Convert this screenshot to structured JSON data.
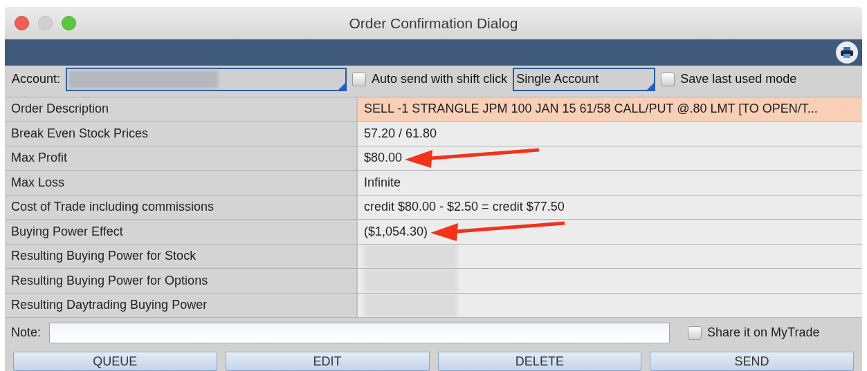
{
  "window": {
    "title": "Order Confirmation Dialog"
  },
  "account": {
    "label": "Account:",
    "redacted": true
  },
  "auto_send": {
    "label": "Auto send with shift click",
    "checked": false
  },
  "mode": {
    "value": "Single Account"
  },
  "save_mode": {
    "label": "Save last used mode",
    "checked": false
  },
  "rows": [
    {
      "label": "Order Description",
      "value": "SELL -1 STRANGLE JPM 100 JAN 15 61/58 CALL/PUT @.80 LMT [TO OPEN/T...",
      "highlight": true,
      "arrow": false,
      "redacted": false
    },
    {
      "label": "Break Even Stock Prices",
      "value": "57.20 / 61.80",
      "highlight": false,
      "arrow": false,
      "redacted": false
    },
    {
      "label": "Max Profit",
      "value": "$80.00",
      "highlight": false,
      "arrow": true,
      "redacted": false
    },
    {
      "label": "Max Loss",
      "value": "Infinite",
      "highlight": false,
      "arrow": false,
      "redacted": false
    },
    {
      "label": "Cost of Trade including commissions",
      "value": "credit $80.00 - $2.50 = credit $77.50",
      "highlight": false,
      "arrow": false,
      "redacted": false
    },
    {
      "label": "Buying Power Effect",
      "value": "($1,054.30)",
      "highlight": false,
      "arrow": true,
      "redacted": false
    },
    {
      "label": "Resulting Buying Power for Stock",
      "highlight": false,
      "arrow": false,
      "redacted": true
    },
    {
      "label": "Resulting Buying Power for Options",
      "highlight": false,
      "arrow": false,
      "redacted": true
    },
    {
      "label": "Resulting Daytrading Buying Power",
      "highlight": false,
      "arrow": false,
      "redacted": true
    }
  ],
  "note": {
    "label": "Note:"
  },
  "share": {
    "label": "Share it on MyTrade",
    "checked": false
  },
  "buttons": [
    "QUEUE",
    "EDIT",
    "DELETE",
    "SEND"
  ]
}
